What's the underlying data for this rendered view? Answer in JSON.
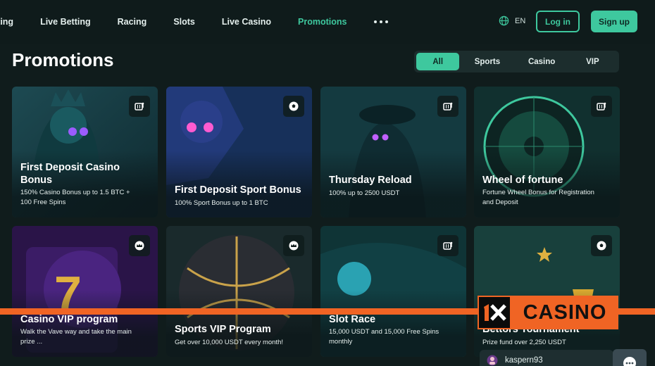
{
  "nav": {
    "items": [
      {
        "label": "tting",
        "active": false
      },
      {
        "label": "Live Betting",
        "active": false
      },
      {
        "label": "Racing",
        "active": false
      },
      {
        "label": "Slots",
        "active": false
      },
      {
        "label": "Live Casino",
        "active": false
      },
      {
        "label": "Promotions",
        "active": true
      }
    ],
    "more_icon": "more-dots-icon"
  },
  "header": {
    "language": "EN",
    "login_label": "Log in",
    "signup_label": "Sign up",
    "accent": "#3ec89e"
  },
  "page": {
    "title": "Promotions"
  },
  "filters": [
    {
      "label": "All",
      "active": true
    },
    {
      "label": "Sports",
      "active": false
    },
    {
      "label": "Casino",
      "active": false
    },
    {
      "label": "VIP",
      "active": false
    }
  ],
  "promos": [
    {
      "title_lines": [
        "First Deposit Casino",
        "Bonus"
      ],
      "subtitle_lines": [
        "150% Casino Bonus up to 1.5 BTC +",
        "100 Free Spins"
      ],
      "badge_icon": "slot-machine-icon"
    },
    {
      "title_lines": [
        "First Deposit Sport Bonus"
      ],
      "subtitle_lines": [
        "100% Sport Bonus up to 1 BTC"
      ],
      "badge_icon": "soccer-ball-icon"
    },
    {
      "title_lines": [
        "Thursday Reload"
      ],
      "subtitle_lines": [
        "100% up to 2500 USDT"
      ],
      "badge_icon": "slot-machine-icon"
    },
    {
      "title_lines": [
        "Wheel of fortune"
      ],
      "subtitle_lines": [
        "Fortune Wheel Bonus for Registration",
        "and Deposit"
      ],
      "badge_icon": "slot-machine-icon"
    },
    {
      "title_lines": [
        "Casino VIP program"
      ],
      "subtitle_lines": [
        "Walk the Vave way and take the main",
        "prize ..."
      ],
      "badge_icon": "crown-icon"
    },
    {
      "title_lines": [
        "Sports VIP Program"
      ],
      "subtitle_lines": [
        "Get over 10,000 USDT every month!"
      ],
      "badge_icon": "crown-icon"
    },
    {
      "title_lines": [
        "Slot Race"
      ],
      "subtitle_lines": [
        "15,000 USDT and 15,000 Free Spins",
        "monthly"
      ],
      "badge_icon": "slot-machine-icon"
    },
    {
      "title_lines": [
        "Bettors Tournament"
      ],
      "subtitle_lines": [
        "Prize fund over 2,250 USDT"
      ],
      "badge_icon": "soccer-ball-icon"
    }
  ],
  "overlay": {
    "logo_text": "CASINO",
    "logo_mark": "1x",
    "banner_color": "#f06424"
  },
  "user": {
    "name": "kaspern93"
  }
}
